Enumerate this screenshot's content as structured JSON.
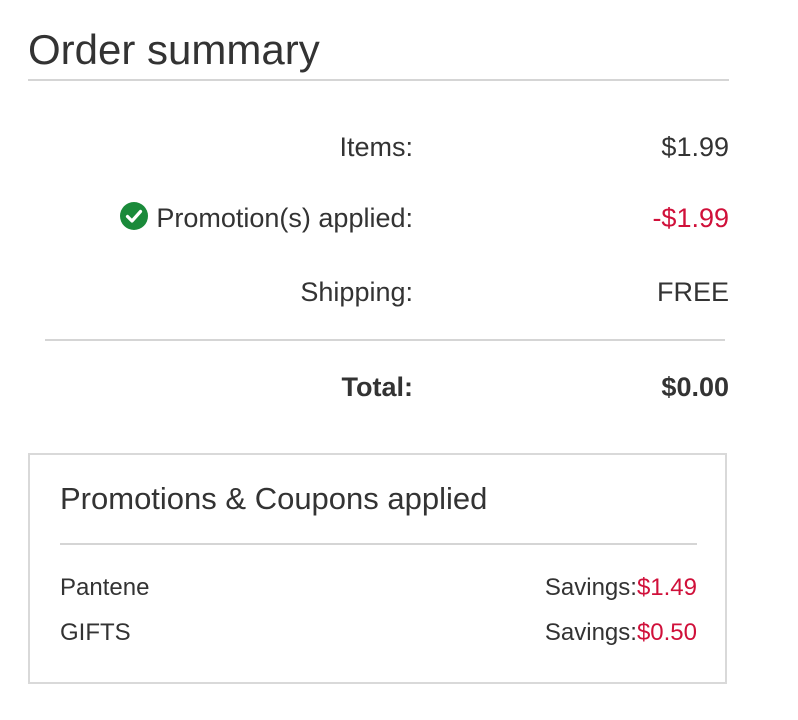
{
  "order_summary": {
    "title": "Order summary",
    "rows": [
      {
        "label": "Items:",
        "value": "$1.99"
      },
      {
        "label": "Promotion(s) applied:",
        "value": "-$1.99"
      },
      {
        "label": "Shipping:",
        "value": "FREE"
      }
    ],
    "total": {
      "label": "Total:",
      "value": "$0.00"
    },
    "icons": {
      "promotion_check": "check-circle-icon"
    },
    "colors": {
      "discount": "#d0103a",
      "check": "#1a8a3a",
      "text": "#333333"
    }
  },
  "promotions": {
    "title": "Promotions & Coupons applied",
    "items": [
      {
        "name": "Pantene",
        "savings_label": "Savings:",
        "savings_value": "$1.49"
      },
      {
        "name": "GIFTS",
        "savings_label": "Savings:",
        "savings_value": "$0.50"
      }
    ]
  }
}
